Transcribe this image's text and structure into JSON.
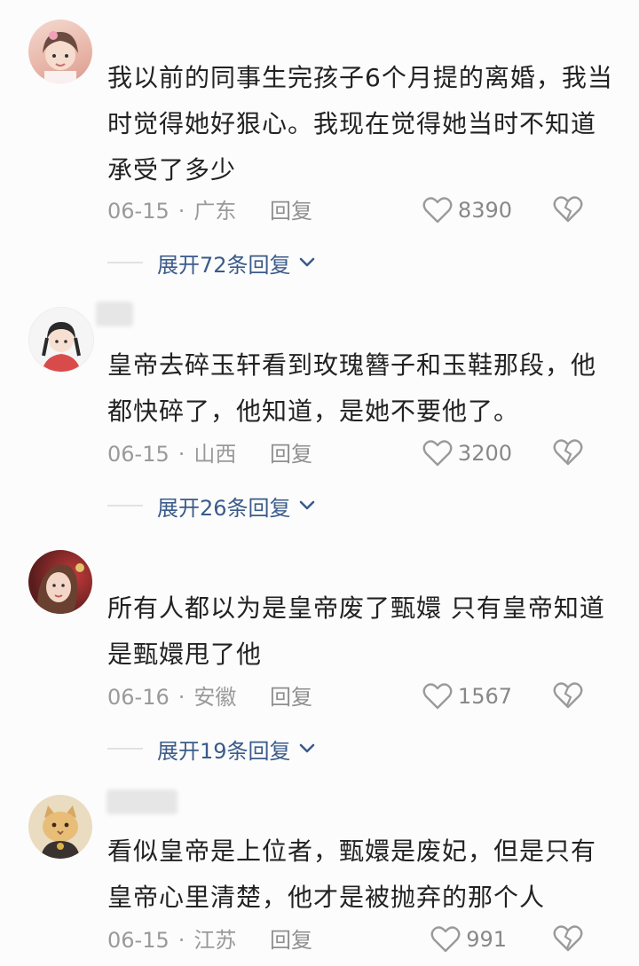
{
  "comments": [
    {
      "text": "我以前的同事生完孩子6个月提的离婚，我当时觉得她好狠心。我现在觉得她当时不知道承受了多少",
      "date": "06-15",
      "location": "广东",
      "reply": "回复",
      "likes": "8390",
      "expand": "展开72条回复"
    },
    {
      "text": "皇帝去碎玉轩看到玫瑰簪子和玉鞋那段，他都快碎了，他知道，是她不要他了。",
      "date": "06-15",
      "location": "山西",
      "reply": "回复",
      "likes": "3200",
      "expand": "展开26条回复"
    },
    {
      "text": "所有人都以为是皇帝废了甄嬛 只有皇帝知道是甄嬛甩了他",
      "date": "06-16",
      "location": "安徽",
      "reply": "回复",
      "likes": "1567",
      "expand": "展开19条回复"
    },
    {
      "text": "看似皇帝是上位者，甄嬛是废妃，但是只有皇帝心里清楚，他才是被抛弃的那个人",
      "date": "06-15",
      "location": "江苏",
      "reply": "回复",
      "likes": "991"
    }
  ],
  "meta_separator": "·",
  "colors": {
    "link": "#3b5b8a",
    "meta": "#9a9a9a",
    "text": "#222222"
  }
}
